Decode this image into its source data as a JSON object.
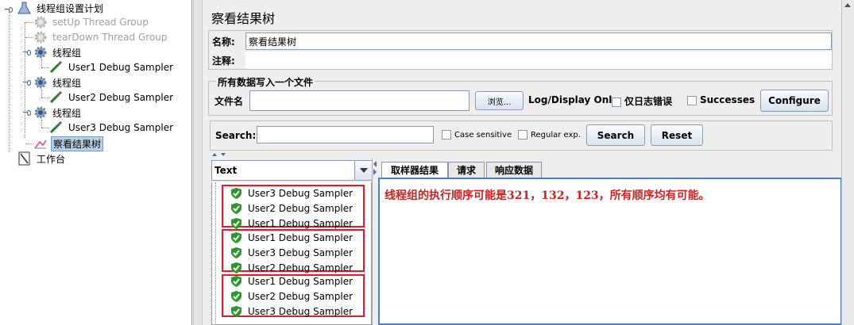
{
  "tree": {
    "root": "线程组设置计划",
    "setup_group": "setUp Thread Group",
    "teardown_group": "tearDown Thread Group",
    "groups": [
      {
        "label": "线程组",
        "sampler": "User1  Debug Sampler"
      },
      {
        "label": "线程组",
        "sampler": "User2  Debug Sampler"
      },
      {
        "label": "线程组",
        "sampler": "User3  Debug Sampler"
      }
    ],
    "listener": "察看结果树",
    "workbench": "工作台"
  },
  "panel": {
    "title": "察看结果树",
    "name_label": "名称:",
    "name_value": "察看结果树",
    "comment_label": "注释:",
    "file_section_title": "所有数据写入一个文件",
    "filename_label": "文件名",
    "browse_button": "浏览...",
    "log_display_label": "Log/Display Only:",
    "errors_only_label": "仅日志错误",
    "successes_label": "Successes",
    "configure_button": "Configure",
    "search_label": "Search:",
    "case_sensitive_label": "Case sensitive",
    "regex_label": "Regular exp.",
    "search_button": "Search",
    "reset_button": "Reset",
    "renderer_selected": "Text"
  },
  "results": {
    "groups": [
      [
        "User3  Debug Sampler",
        "User2  Debug Sampler",
        "User1  Debug Sampler"
      ],
      [
        "User1  Debug Sampler",
        "User3  Debug Sampler",
        "User2  Debug Sampler"
      ],
      [
        "User1  Debug Sampler",
        "User2  Debug Sampler",
        "User3  Debug Sampler"
      ]
    ]
  },
  "tabs": [
    "取样器结果",
    "请求",
    "响应数据"
  ],
  "annotation": "线程组的执行顺序可能是321，132，123，所有顺序均有可能。",
  "colors": {
    "highlight_box": "#e01b24",
    "annotation_text": "#d02020",
    "success_shield": "#2a9a2a"
  }
}
